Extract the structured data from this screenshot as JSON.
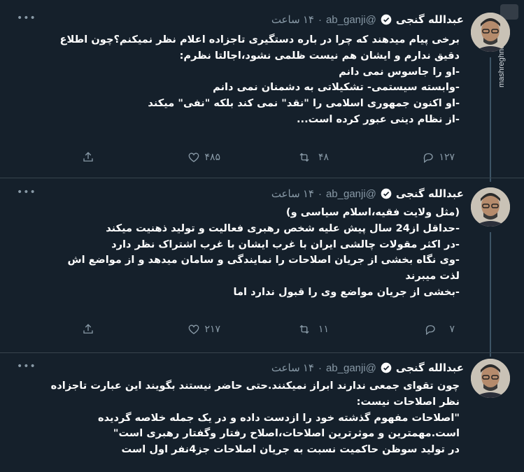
{
  "watermark": {
    "text": "mashreghnews.ir"
  },
  "tweets": [
    {
      "name": "عبدالله گنجی",
      "handle": "@ab_ganji",
      "time": "۱۴ ساعت",
      "lines": [
        "برخی پیام میدهند که چرا در باره دستگیری تاجزاده اعلام نظر نمیکنم؟چون اطلاع",
        "دقیق ندارم  و ایشان هم نیست ظلمی نشود،اجالتا نظرم:",
        "-او را جاسوس نمی دانم",
        "-وابسته سیستمی- تشکیلاتی به دشمنان نمی دانم",
        "-او اکنون جمهوری اسلامی را \"نقد\" نمی کند بلکه \"نفی\" میکند",
        "-از نظام دینی عبور کرده است..."
      ],
      "replies": "۱۲۷",
      "retweets": "۴۸",
      "likes": "۴۸۵"
    },
    {
      "name": "عبدالله گنجی",
      "handle": "@ab_ganji",
      "time": "۱۴ ساعت",
      "lines": [
        "(مثل ولایت فقیه،اسلام سیاسی و)",
        "-حداقل از24 سال پیش علیه شخص رهبری فعالیت و تولید ذهنیت میکند",
        "-در اکثر مقولات چالشی ایران با غرب ایشان با غرب اشتراک نظر دارد",
        "-وی نگاه بخشی از جریان اصلاحات را نمایندگی و سامان میدهد و از مواضع اش",
        "لذت میبرند",
        "-بخشی از جریان مواضع وی را قبول ندارد اما"
      ],
      "replies": "۷",
      "retweets": "۱۱",
      "likes": "۲۱۷"
    },
    {
      "name": "عبدالله گنجی",
      "handle": "@ab_ganji",
      "time": "۱۴ ساعت",
      "lines": [
        "چون تقوای جمعی ندارند ابراز نمیکنند.حتی حاضر نیستند بگویند این عبارت تاجزاده",
        "نظر اصلاحات نیست:",
        "\"اصلاحات مفهوم گذشته خود را ازدست داده و در یک جمله خلاصه گردیده",
        "است.مهمترین و موثرترین اصلاحات،اصلاح رفتار وگفتار رهبری است\"",
        "در تولید سوظن حاکمیت نسبت به جریان اصلاحات جز4نفر اول است"
      ]
    }
  ]
}
